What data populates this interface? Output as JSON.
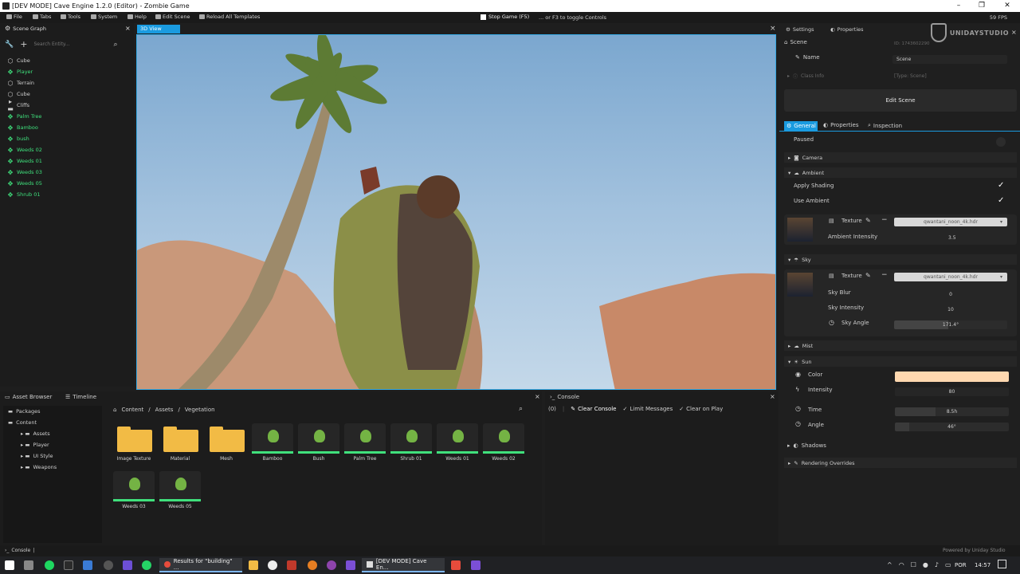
{
  "titlebar": {
    "title": "[DEV MODE] Cave Engine 1.2.0 (Editor) - Zombie Game"
  },
  "menubar": {
    "items": [
      {
        "label": "File",
        "icon": "file-icon"
      },
      {
        "label": "Tabs",
        "icon": "tabs-icon"
      },
      {
        "label": "Tools",
        "icon": "tools-icon"
      },
      {
        "label": "System",
        "icon": "system-icon"
      },
      {
        "label": "Help",
        "icon": "help-icon"
      },
      {
        "label": "Edit Scene",
        "icon": "edit-icon"
      },
      {
        "label": "Reload All Templates",
        "icon": "reload-icon"
      }
    ],
    "stop_game": "Stop Game (F5)",
    "toggle_hint": "... or F3 to toggle Controls",
    "fps": "59 FPS"
  },
  "scene_graph": {
    "tab": "Scene Graph",
    "search_placeholder": "Search Entity...",
    "items": [
      {
        "label": "Cube",
        "color": "white",
        "glyph": "cube-icon"
      },
      {
        "label": "Player",
        "color": "green",
        "glyph": "entity-icon"
      },
      {
        "label": "Terrain",
        "color": "white",
        "glyph": "cube-icon"
      },
      {
        "label": "Cube",
        "color": "white",
        "glyph": "cube-icon"
      },
      {
        "label": "Cliffs",
        "color": "white",
        "glyph": "folder-icon"
      },
      {
        "label": "Palm Tree",
        "color": "green",
        "glyph": "entity-icon"
      },
      {
        "label": "Bamboo",
        "color": "green",
        "glyph": "entity-icon"
      },
      {
        "label": "bush",
        "color": "green",
        "glyph": "entity-icon"
      },
      {
        "label": "Weeds 02",
        "color": "green",
        "glyph": "entity-icon"
      },
      {
        "label": "Weeds 01",
        "color": "green",
        "glyph": "entity-icon"
      },
      {
        "label": "Weeds 03",
        "color": "green",
        "glyph": "entity-icon"
      },
      {
        "label": "Weeds 05",
        "color": "green",
        "glyph": "entity-icon"
      },
      {
        "label": "Shrub 01",
        "color": "green",
        "glyph": "entity-icon"
      }
    ]
  },
  "viewport": {
    "tab": "3D View"
  },
  "right_panel": {
    "tabs": [
      {
        "label": "Settings"
      },
      {
        "label": "Properties"
      }
    ],
    "logo": "UNIDAYSTUDIO",
    "scene_tab": "Scene",
    "id_label": "ID: 1743602290",
    "name_label": "Name",
    "name_value": "Scene",
    "class_info_label": "Class Info",
    "class_info_value": "[Type: Scene]",
    "edit_scene_button": "Edit Scene",
    "subtabs": [
      {
        "label": "General"
      },
      {
        "label": "Properties"
      },
      {
        "label": "Inspection"
      }
    ],
    "paused_label": "Paused",
    "camera_label": "Camera",
    "ambient": {
      "label": "Ambient",
      "apply_shading": "Apply Shading",
      "use_ambient": "Use Ambient",
      "texture_label": "Texture",
      "texture_value": "qwantani_noon_4k.hdr",
      "intensity_label": "Ambient Intensity",
      "intensity_value": "3.5"
    },
    "sky": {
      "label": "Sky",
      "texture_label": "Texture",
      "texture_value": "qwantani_noon_4k.hdr",
      "blur_label": "Sky Blur",
      "blur_value": "0",
      "intensity_label": "Sky Intensity",
      "intensity_value": "10",
      "angle_label": "Sky Angle",
      "angle_value": "171.4°",
      "angle_fraction": 0.476
    },
    "mist_label": "Mist",
    "sun": {
      "label": "Sun",
      "color_label": "Color",
      "color_value": "#ffd8b0",
      "intensity_label": "Intensity",
      "intensity_value": "80",
      "time_label": "Time",
      "time_value": "8.5h",
      "time_fraction": 0.354,
      "angle_label": "Angle",
      "angle_value": "46°",
      "angle_fraction": 0.128
    },
    "shadows_label": "Shadows",
    "rendering_overrides_label": "Rendering Overrides"
  },
  "asset_browser": {
    "tabs": [
      {
        "label": "Asset Browser"
      },
      {
        "label": "Timeline"
      }
    ],
    "tree": [
      {
        "label": "Packages",
        "level": 0
      },
      {
        "label": "Content",
        "level": 0
      },
      {
        "label": "Assets",
        "level": 1
      },
      {
        "label": "Player",
        "level": 1
      },
      {
        "label": "UI Style",
        "level": 1
      },
      {
        "label": "Weapons",
        "level": 1
      }
    ],
    "breadcrumb": [
      "Content",
      "/",
      "Assets",
      "/",
      "Vegetation"
    ],
    "assets": [
      {
        "label": "Image Texture",
        "kind": "folder"
      },
      {
        "label": "Material",
        "kind": "folder"
      },
      {
        "label": "Mesh",
        "kind": "folder"
      },
      {
        "label": "Bamboo",
        "kind": "plant"
      },
      {
        "label": "Bush",
        "kind": "plant"
      },
      {
        "label": "Palm Tree",
        "kind": "plant"
      },
      {
        "label": "Shrub 01",
        "kind": "plant"
      },
      {
        "label": "Weeds 01",
        "kind": "plant"
      },
      {
        "label": "Weeds 02",
        "kind": "plant"
      },
      {
        "label": "Weeds 03",
        "kind": "plant"
      },
      {
        "label": "Weeds 05",
        "kind": "plant"
      }
    ]
  },
  "console": {
    "tab": "Console",
    "count": "(0)",
    "clear": "Clear Console",
    "limit": "Limit Messages",
    "clear_on_play": "Clear on Play"
  },
  "statusbar": {
    "left": "Console",
    "right": "Powered by Uniday Studio"
  },
  "taskbar": {
    "chrome_title": "Results for \"building\" ...",
    "cave_title": "[DEV MODE] Cave En...",
    "lang": "POR",
    "time": "14:57"
  }
}
